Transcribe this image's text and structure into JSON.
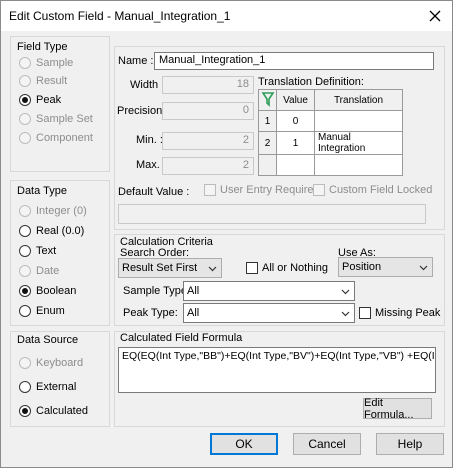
{
  "window": {
    "title": "Edit Custom Field - Manual_Integration_1"
  },
  "field_type": {
    "label": "Field Type",
    "options": [
      {
        "label": "Sample",
        "checked": false,
        "enabled": false
      },
      {
        "label": "Result",
        "checked": false,
        "enabled": false
      },
      {
        "label": "Peak",
        "checked": true,
        "enabled": true
      },
      {
        "label": "Sample Set",
        "checked": false,
        "enabled": false
      },
      {
        "label": "Component",
        "checked": false,
        "enabled": false
      }
    ]
  },
  "data_type": {
    "label": "Data Type",
    "options": [
      {
        "label": "Integer (0)",
        "checked": false,
        "enabled": false
      },
      {
        "label": "Real (0.0)",
        "checked": false,
        "enabled": true
      },
      {
        "label": "Text",
        "checked": false,
        "enabled": true
      },
      {
        "label": "Date",
        "checked": false,
        "enabled": false
      },
      {
        "label": "Boolean",
        "checked": true,
        "enabled": true
      },
      {
        "label": "Enum",
        "checked": false,
        "enabled": true
      }
    ]
  },
  "data_source": {
    "label": "Data Source",
    "options": [
      {
        "label": "Keyboard",
        "checked": false,
        "enabled": false
      },
      {
        "label": "External",
        "checked": false,
        "enabled": true
      },
      {
        "label": "Calculated",
        "checked": true,
        "enabled": true
      }
    ]
  },
  "details": {
    "name_label": "Name :",
    "name_value": "Manual_Integration_1",
    "width_label": "Width :",
    "width_value": "18",
    "precision_label": "Precision :",
    "precision_value": "0",
    "min_label": "Min. :",
    "min_value": "2",
    "max_label": "Max. :",
    "max_value": "2",
    "default_label": "Default Value :",
    "default_value": "",
    "user_entry_label": "User Entry Required",
    "field_locked_label": "Custom Field Locked"
  },
  "translation": {
    "label": "Translation Definition:",
    "columns": [
      "Value",
      "Translation"
    ],
    "rows": [
      {
        "index": "1",
        "value": "0",
        "translation": ""
      },
      {
        "index": "2",
        "value": "1",
        "translation": "Manual Integration"
      },
      {
        "index": "",
        "value": "",
        "translation": ""
      }
    ]
  },
  "calculation": {
    "label": "Calculation Criteria",
    "search_order_label": "Search Order:",
    "search_order_value": "Result Set First",
    "all_or_nothing_label": "All or Nothing",
    "use_as_label": "Use As:",
    "use_as_value": "Position",
    "sample_type_label": "Sample Type:",
    "sample_type_value": "All",
    "peak_type_label": "Peak Type:",
    "peak_type_value": "All",
    "missing_peak_label": "Missing Peak"
  },
  "formula": {
    "label": "Calculated Field Formula",
    "value": "EQ(EQ(Int Type,\"BB\")+EQ(Int Type,\"BV\")+EQ(Int Type,\"VB\") +EQ(Int Type",
    "edit_button": "Edit Formula..."
  },
  "buttons": {
    "ok": "OK",
    "cancel": "Cancel",
    "help": "Help"
  },
  "colors": {
    "accent": "#0078d7",
    "panel": "#f0f0f0",
    "disabled_text": "#8d8d8d",
    "icon_green": "#2e9d57"
  }
}
